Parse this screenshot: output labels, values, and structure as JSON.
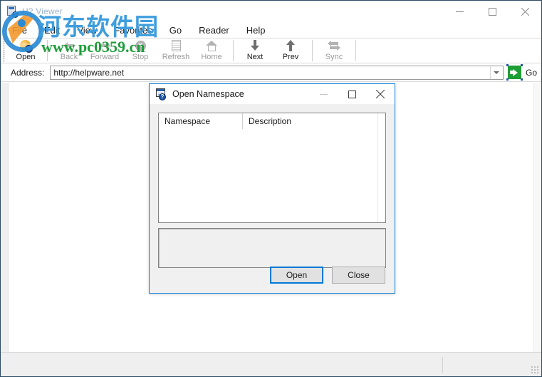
{
  "window": {
    "title": "H2 Viewer",
    "title_icon": "help-viewer-icon",
    "controls": {
      "minimize": "minimize-icon",
      "maximize": "maximize-icon",
      "close": "close-icon"
    }
  },
  "menubar": {
    "items": [
      {
        "label": "File"
      },
      {
        "label": "Edit"
      },
      {
        "label": "View"
      },
      {
        "label": "Favorites"
      },
      {
        "label": "Go"
      },
      {
        "label": "Reader"
      },
      {
        "label": "Help"
      }
    ]
  },
  "toolbar": {
    "buttons": [
      {
        "label": "Open",
        "icon": "open-globe-help-icon",
        "enabled": true
      },
      {
        "label": "Back",
        "icon": "arrow-left-icon",
        "enabled": false
      },
      {
        "label": "Forward",
        "icon": "arrow-right-icon",
        "enabled": false
      },
      {
        "label": "Stop",
        "icon": "stop-icon",
        "enabled": false
      },
      {
        "label": "Refresh",
        "icon": "refresh-page-icon",
        "enabled": false
      },
      {
        "label": "Home",
        "icon": "home-icon",
        "enabled": false
      },
      {
        "label": "Next",
        "icon": "arrow-down-icon",
        "enabled": true
      },
      {
        "label": "Prev",
        "icon": "arrow-up-icon",
        "enabled": true
      },
      {
        "label": "Sync",
        "icon": "sync-arrows-icon",
        "enabled": false
      }
    ]
  },
  "address_bar": {
    "label": "Address:",
    "value": "http://helpware.net",
    "placeholder": "",
    "dropdown_icon": "chevron-down-icon",
    "go_label": "Go",
    "go_icon": "green-arrow-go-icon"
  },
  "statusbar": {
    "text": "",
    "grip_icon": "resize-grip-icon"
  },
  "dialog": {
    "title": "Open Namespace",
    "title_icon": "namespace-help-icon",
    "controls": {
      "minimize": "minimize-icon",
      "maximize": "maximize-icon",
      "close": "close-icon"
    },
    "list": {
      "columns": [
        {
          "label": "Namespace"
        },
        {
          "label": "Description"
        }
      ],
      "rows": []
    },
    "description_box": {
      "value": ""
    },
    "buttons": {
      "open_label": "Open",
      "close_label": "Close"
    }
  },
  "watermark": {
    "cn_text": "河东软件园",
    "url_text": "www.pc0359.cn",
    "cn_color": "#3e9ede",
    "url_color": "#1f9d3a",
    "logo_icon": "site-logo-icon"
  },
  "colors": {
    "accent_blue": "#0078d7",
    "dialog_border": "#1683d8",
    "go_green": "#1e9e34",
    "window_border": "#2b4a63"
  }
}
